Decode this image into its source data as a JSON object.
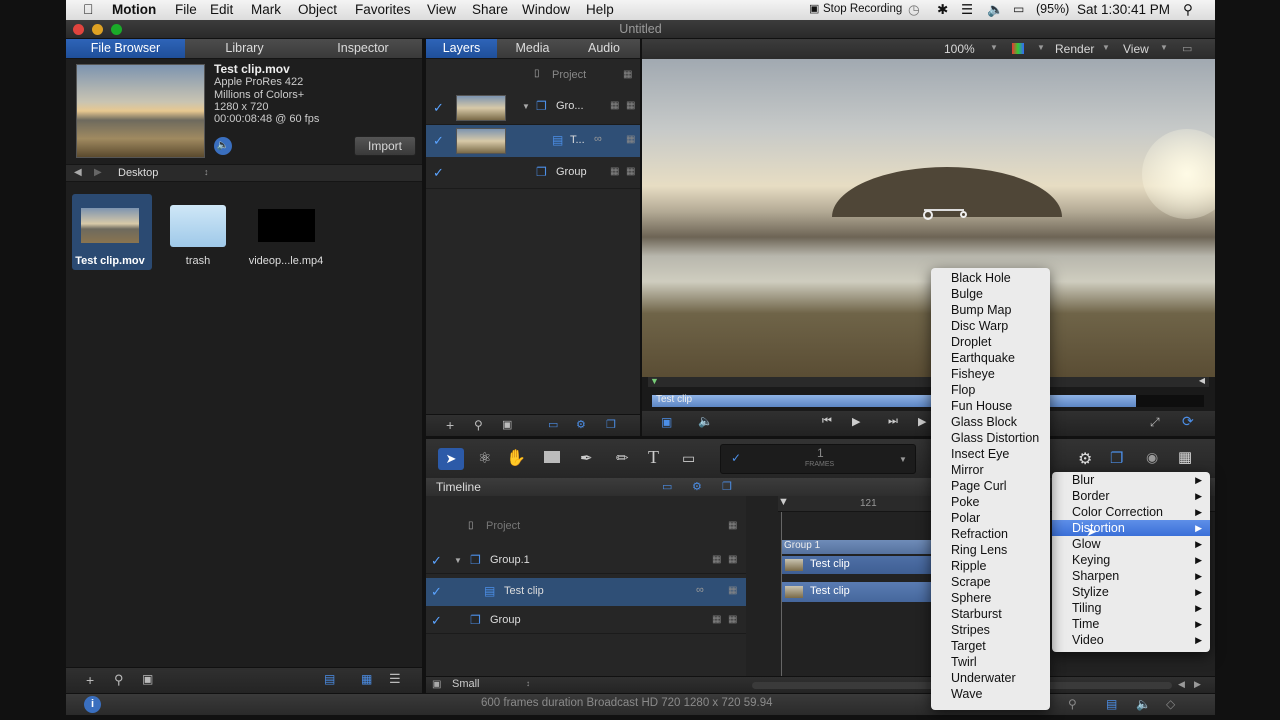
{
  "menubar": {
    "app": "Motion",
    "items": [
      "File",
      "Edit",
      "Mark",
      "Object",
      "Favorites",
      "View",
      "Share",
      "Window",
      "Help"
    ],
    "stop_recording": "Stop Recording",
    "battery": "(95%)",
    "clock": "Sat 1:30:41 PM"
  },
  "window": {
    "title": "Untitled"
  },
  "left_tabs": [
    "File Browser",
    "Library",
    "Inspector"
  ],
  "preview": {
    "name": "Test clip.mov",
    "codec": "Apple ProRes 422",
    "colors": "Millions of Colors+",
    "size": "1280 x 720",
    "duration": "00:00:08:48 @ 60 fps",
    "import_label": "Import"
  },
  "browser": {
    "location": "Desktop",
    "files": [
      {
        "name": "Test clip.mov",
        "kind": "video"
      },
      {
        "name": "trash",
        "kind": "folder"
      },
      {
        "name": "videop...le.mp4",
        "kind": "black"
      }
    ]
  },
  "layers_tabs": [
    "Layers",
    "Media",
    "Audio"
  ],
  "layers": {
    "project": "Project",
    "rows": [
      {
        "label": "Gro...",
        "checked": true
      },
      {
        "label": "T...",
        "checked": true
      },
      {
        "label": "Group",
        "checked": true
      }
    ]
  },
  "viewer": {
    "zoom": "100%",
    "render": "Render",
    "view": "View",
    "clip_label": "Test clip"
  },
  "timeline": {
    "title": "Timeline",
    "project": "Project",
    "ruler_mark": "121",
    "frames_label": "FRAMES",
    "frame_value": "1",
    "rows": [
      "Group.1",
      "Test clip",
      "Group"
    ],
    "bars": [
      "Group 1",
      "Test clip",
      "Test clip"
    ],
    "size_label": "Small"
  },
  "status": {
    "text": "600 frames duration Broadcast HD 720 1280 x 720 59.94"
  },
  "filter_menu": {
    "items": [
      "Blur",
      "Border",
      "Color Correction",
      "Distortion",
      "Glow",
      "Keying",
      "Sharpen",
      "Stylize",
      "Tiling",
      "Time",
      "Video"
    ],
    "highlighted": "Distortion"
  },
  "distortion_menu": {
    "items": [
      "Black Hole",
      "Bulge",
      "Bump Map",
      "Disc Warp",
      "Droplet",
      "Earthquake",
      "Fisheye",
      "Flop",
      "Fun House",
      "Glass Block",
      "Glass Distortion",
      "Insect Eye",
      "Mirror",
      "Page Curl",
      "Poke",
      "Polar",
      "Refraction",
      "Ring Lens",
      "Ripple",
      "Scrape",
      "Sphere",
      "Starburst",
      "Stripes",
      "Target",
      "Twirl",
      "Underwater",
      "Wave"
    ]
  },
  "colors": {
    "accent": "#2e64b8",
    "selection": "#3a6fd8",
    "check": "#5aa3ff"
  }
}
